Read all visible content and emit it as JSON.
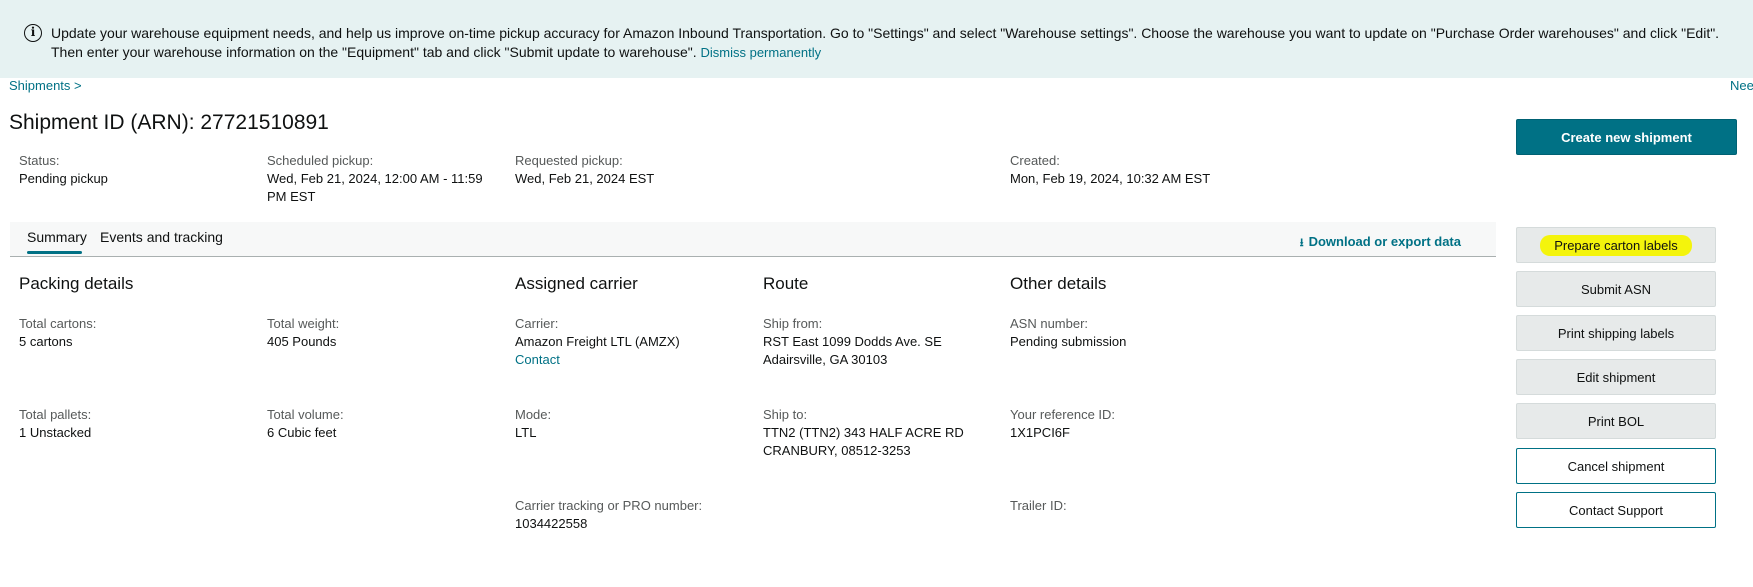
{
  "banner": {
    "text": "Update your warehouse equipment needs, and help us improve on-time pickup accuracy for Amazon Inbound Transportation. Go to \"Settings\" and select \"Warehouse settings\". Choose the warehouse you want to update on \"Purchase Order warehouses\" and click \"Edit\". Then enter your warehouse information on the \"Equipment\" tab and click \"Submit update to warehouse\".",
    "dismiss": "Dismiss permanently"
  },
  "breadcrumb": "Shipments >",
  "need_help": "Nee",
  "title": "Shipment ID (ARN): 27721510891",
  "summary": {
    "status_label": "Status:",
    "status_value": "Pending pickup",
    "scheduled_label": "Scheduled pickup:",
    "scheduled_value": "Wed, Feb 21, 2024, 12:00 AM - 11:59 PM EST",
    "requested_label": "Requested pickup:",
    "requested_value": "Wed, Feb 21, 2024 EST",
    "created_label": "Created:",
    "created_value": "Mon, Feb 19, 2024, 10:32 AM EST"
  },
  "tabs": {
    "summary": "Summary",
    "events": "Events and tracking",
    "download": "Download or export data"
  },
  "sections": {
    "packing": "Packing details",
    "carrier": "Assigned carrier",
    "route": "Route",
    "other": "Other details"
  },
  "packing": {
    "cartons_label": "Total cartons:",
    "cartons_value": "5 cartons",
    "weight_label": "Total weight:",
    "weight_value": "405 Pounds",
    "pallets_label": "Total pallets:",
    "pallets_value": "1 Unstacked",
    "volume_label": "Total volume:",
    "volume_value": "6 Cubic feet"
  },
  "carrier": {
    "carrier_label": "Carrier:",
    "carrier_value": "Amazon Freight LTL (AMZX)",
    "contact": "Contact",
    "mode_label": "Mode:",
    "mode_value": "LTL",
    "tracking_label": "Carrier tracking or PRO number:",
    "tracking_value": "1034422558"
  },
  "route": {
    "from_label": "Ship from:",
    "from_line1": "RST East 1099 Dodds Ave. SE",
    "from_line2": "Adairsville, GA 30103",
    "to_label": "Ship to:",
    "to_line1": "TTN2 (TTN2) 343 HALF ACRE RD",
    "to_line2": "CRANBURY, 08512-3253"
  },
  "other": {
    "asn_label": "ASN number:",
    "asn_value": "Pending submission",
    "ref_label": "Your reference ID:",
    "ref_value": "1X1PCI6F",
    "trailer_label": "Trailer ID:"
  },
  "actions": {
    "create": "Create new shipment",
    "prepare": "Prepare carton labels",
    "submit_asn": "Submit ASN",
    "print_shipping": "Print shipping labels",
    "edit": "Edit shipment",
    "print_bol": "Print BOL",
    "cancel": "Cancel shipment",
    "contact_support": "Contact Support"
  },
  "colors": {
    "accent": "#007185",
    "banner_bg": "#e6f2f2",
    "highlight": "#f4f40c"
  }
}
